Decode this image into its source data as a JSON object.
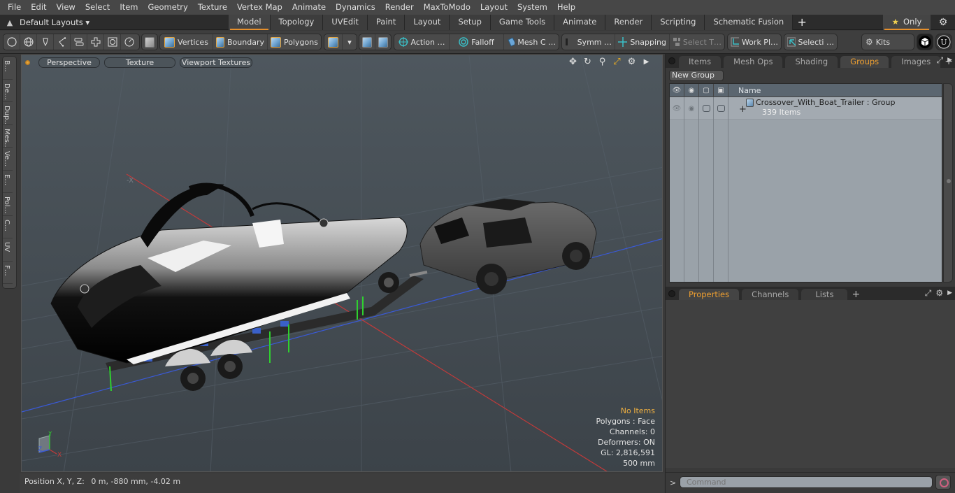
{
  "menubar": {
    "items": [
      "File",
      "Edit",
      "View",
      "Select",
      "Item",
      "Geometry",
      "Texture",
      "Vertex Map",
      "Animate",
      "Dynamics",
      "Render",
      "MaxToModo",
      "Layout",
      "System",
      "Help"
    ]
  },
  "layoutbar": {
    "layouts_label": "Default Layouts ▾",
    "tabs": [
      "Model",
      "Topology",
      "UVEdit",
      "Paint",
      "Layout",
      "Setup",
      "Game Tools",
      "Animate",
      "Render",
      "Scripting",
      "Schematic Fusion"
    ],
    "active_tab": "Model",
    "add_tab": "+",
    "only_label": "Only",
    "only_icon": "★"
  },
  "toolbar": {
    "selection_modes": [
      "Vertices",
      "Boundary",
      "Polygons"
    ],
    "action_label": "Action …",
    "falloff_label": "Falloff",
    "mesh_label": "Mesh C …",
    "symm_label": "Symm …",
    "snapping_label": "Snapping",
    "select_t_label": "Select T…",
    "workplane_label": "Work Pl…",
    "selection_label": "Selecti …",
    "kits_label": "Kits"
  },
  "leftstrip": {
    "tabs": [
      "B…",
      "De…",
      "Dup…",
      "Mes…",
      "Ve…",
      "E…",
      "Pol…",
      "C…",
      "UV",
      "F…"
    ]
  },
  "viewport": {
    "view_mode": "Perspective",
    "shading": "Texture",
    "textures": "Viewport Textures",
    "info": {
      "selection": "No Items",
      "polygons": "Polygons : Face",
      "channels": "Channels: 0",
      "deformers": "Deformers: ON",
      "gl": "GL: 2,816,591",
      "unit": "500 mm"
    },
    "gizmo": {
      "x": "X",
      "y": "Y",
      "z": "Z"
    },
    "axis_label": "-X",
    "colors": {
      "x_axis": "#c23a3a",
      "y_axis": "#2fd02f",
      "z_axis": "#3a5ad8",
      "background": "#4a5259"
    }
  },
  "statusbar": {
    "position_label": "Position X, Y, Z:",
    "position_value": "0 m, -880 mm, -4.02 m"
  },
  "rightpanel": {
    "top_tabs": [
      "Items",
      "Mesh Ops",
      "Shading",
      "Groups",
      "Images"
    ],
    "top_active": "Groups",
    "new_group_label": "New Group",
    "table_header_name": "Name",
    "groups": [
      {
        "name": "Crossover_With_Boat_Trailer : Group",
        "count": "339 Items"
      }
    ],
    "bottom_tabs": [
      "Properties",
      "Channels",
      "Lists"
    ],
    "bottom_active": "Properties",
    "add_tab": "+"
  },
  "command": {
    "prompt": ">",
    "placeholder": "Command"
  },
  "accent_color": "#e7902c"
}
